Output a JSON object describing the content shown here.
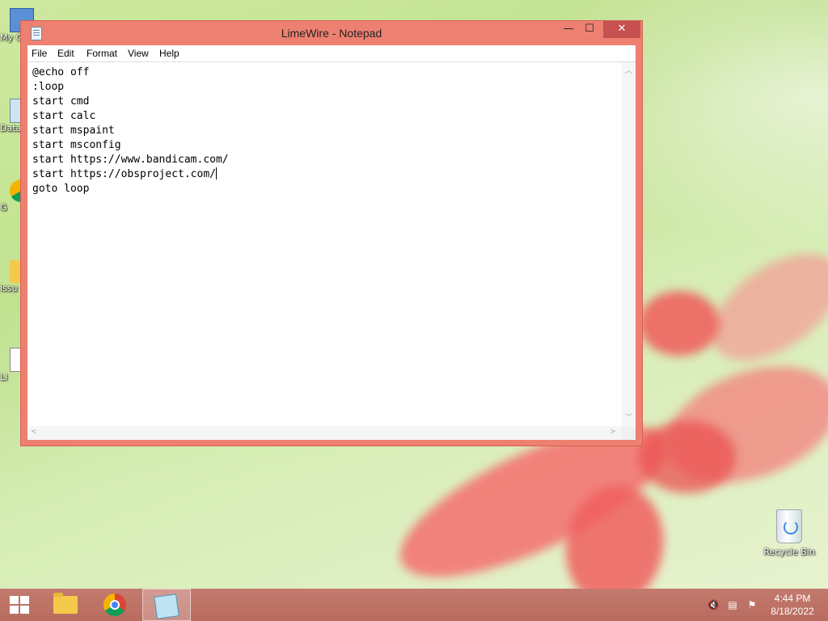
{
  "window": {
    "title": "LimeWire - Notepad",
    "controls": {
      "minimize": "—",
      "maximize": "☐",
      "close": "✕"
    }
  },
  "menu": {
    "file": "File",
    "edit": "Edit",
    "format": "Format",
    "view": "View",
    "help": "Help"
  },
  "editor": {
    "lines": [
      "@echo off",
      ":loop",
      "start cmd",
      "start calc",
      "start mspaint",
      "start msconfig",
      "start https://www.bandicam.com/",
      "start https://obsproject.com/",
      "goto loop"
    ]
  },
  "desktop": {
    "icons": [
      {
        "label": "My C",
        "icon": "computer-icon"
      },
      {
        "label": "Data",
        "icon": "shortcut-icon"
      },
      {
        "label": "G",
        "icon": "chrome-shortcut-icon"
      },
      {
        "label": "issu",
        "icon": "folder-icon"
      },
      {
        "label": "Li",
        "icon": "text-file-icon"
      }
    ],
    "recycle_bin": "Recycle Bin"
  },
  "taskbar": {
    "apps": [
      "start-icon",
      "file-explorer-icon",
      "chrome-icon",
      "notepad-icon"
    ],
    "time": "4:44 PM",
    "date": "8/18/2022"
  },
  "colors": {
    "titlebar": "#ee8071",
    "close_button": "#c75050",
    "taskbar": "#c47a6e"
  }
}
